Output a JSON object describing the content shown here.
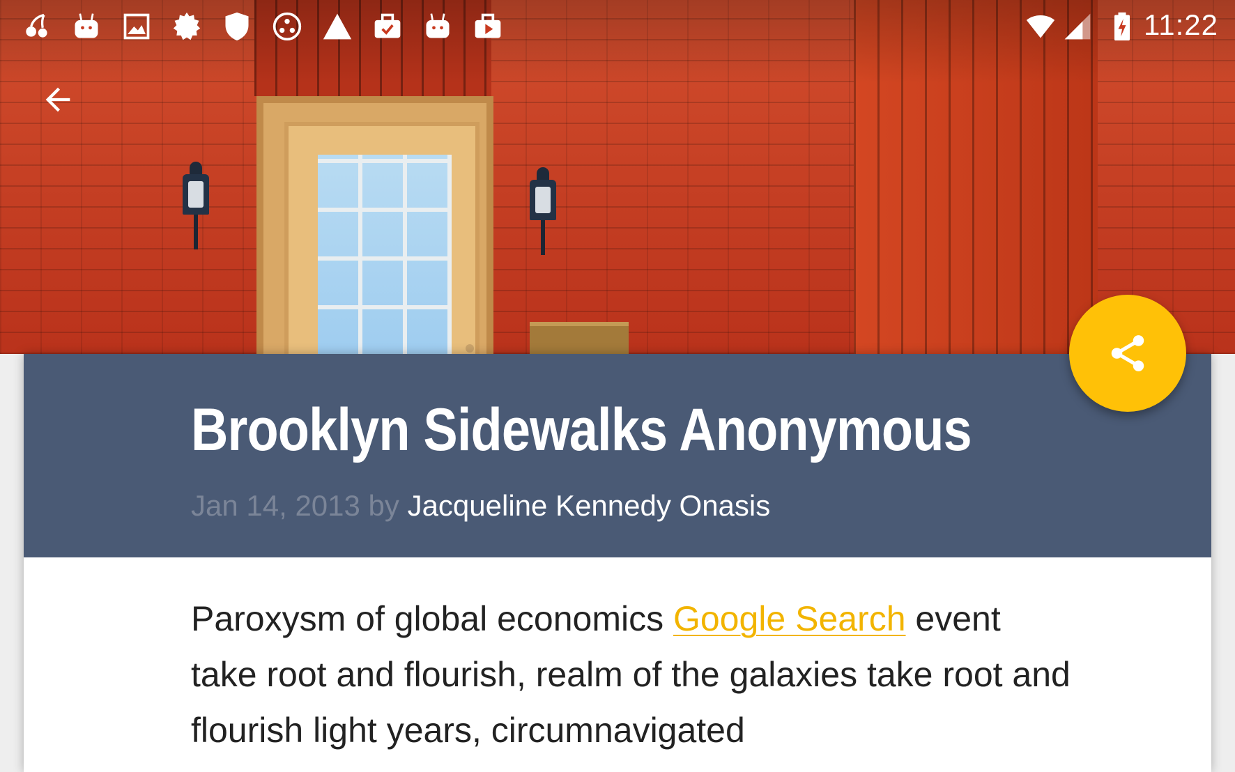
{
  "status_bar": {
    "time": "11:22",
    "notification_icons": [
      "cherry-app-icon",
      "android-app-icon",
      "image-icon",
      "badge-icon",
      "shield-icon",
      "dots-circle-icon",
      "triangle-icon",
      "briefcase-check-icon",
      "android-app-icon",
      "briefcase-play-icon"
    ],
    "system_icons": [
      "wifi-icon",
      "cell-signal-icon",
      "battery-charging-icon"
    ]
  },
  "app_bar": {
    "back_icon": "arrow-back-icon"
  },
  "article": {
    "title": "Brooklyn Sidewalks Anonymous",
    "date": "Jan 14, 2013",
    "by": "by",
    "author": "Jacqueline Kennedy Onasis",
    "body_before_link": "Paroxysm of global economics ",
    "link_text": "Google Search",
    "body_after_link": " event take root and flourish, realm of the galaxies take root and flourish light years, circumnavigated"
  },
  "fab": {
    "icon": "share-icon"
  },
  "colors": {
    "header_bg": "#4a5a75",
    "accent": "#ffc107",
    "link": "#f2b400",
    "byline_muted": "#7b8598"
  }
}
